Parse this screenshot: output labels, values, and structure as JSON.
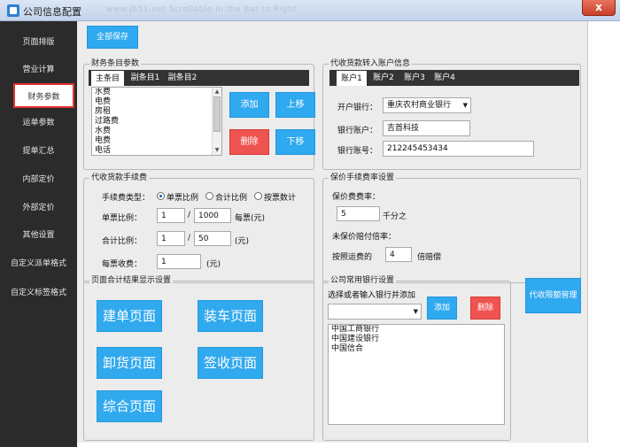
{
  "window": {
    "title": "公司信息配置",
    "faint_url": "www.jb51.net  Scrollable in the Bar to Right",
    "close_label": "x"
  },
  "sidebar": {
    "items": [
      {
        "label": "页面排版"
      },
      {
        "label": "营业计算"
      },
      {
        "label": "财务参数"
      },
      {
        "label": "运单参数"
      },
      {
        "label": "提单汇总"
      },
      {
        "label": "内部定价"
      },
      {
        "label": "外部定价"
      },
      {
        "label": "其他设置"
      },
      {
        "label": "自定义派单格式"
      },
      {
        "label": "自定义标签格式"
      }
    ]
  },
  "toolbar": {
    "save_all": "全部保存"
  },
  "finance_subject": {
    "title": "财务条目参数",
    "tabs": [
      "主条目",
      "副条目1",
      "副条目2"
    ],
    "items": [
      "水费",
      "电费",
      "房租",
      "过路费",
      "水费",
      "电费",
      "电话"
    ],
    "buttons": {
      "add": "添加",
      "move_up": "上移",
      "delete": "删除",
      "move_down": "下移"
    }
  },
  "collection_account": {
    "title": "代收货款转入账户信息",
    "tabs": [
      "账户1",
      "账户2",
      "账户3",
      "账户4"
    ],
    "bank_label": "开户银行：",
    "bank_value": "重庆农村商业银行",
    "account_name_label": "银行账户：",
    "account_name_value": "吉首科技",
    "account_no_label": "银行账号：",
    "account_no_value": "212245453434"
  },
  "collection_fee": {
    "title": "代收货款手续费",
    "fee_type_label": "手续费类型：",
    "options": [
      "单票比例",
      "合计比例",
      "按票数计"
    ],
    "single_ratio_label": "单票比例：",
    "single_ratio_a": "1",
    "single_ratio_b": "1000",
    "single_ratio_unit": "每票(元)",
    "total_ratio_label": "合计比例：",
    "total_ratio_a": "1",
    "total_ratio_b": "50",
    "total_ratio_unit": "(元)",
    "per_ticket_label": "每票收费：",
    "per_ticket_value": "1",
    "per_ticket_unit": "(元)",
    "slash": "/"
  },
  "insurance_fee": {
    "title": "保价手续费率设置",
    "rate_label": "保价费费率：",
    "rate_value": "5",
    "rate_unit": "千分之",
    "no_insure_label": "未保价赔付倍率：",
    "compensate_label": "按照运费的",
    "compensate_value": "4",
    "compensate_unit": "倍赔偿"
  },
  "page_display": {
    "title": "页面合计结果显示设置",
    "buttons": [
      "建单页面",
      "装车页面",
      "卸货页面",
      "签收页面",
      "综合页面"
    ]
  },
  "common_banks": {
    "title": "公司常用银行设置",
    "hint": "选择或者输入银行并添加",
    "add": "添加",
    "delete": "删除",
    "banks": [
      "中国工商银行",
      "中国建设银行",
      "中国信合"
    ]
  },
  "collection_manage": {
    "label": "代收限额管理"
  }
}
